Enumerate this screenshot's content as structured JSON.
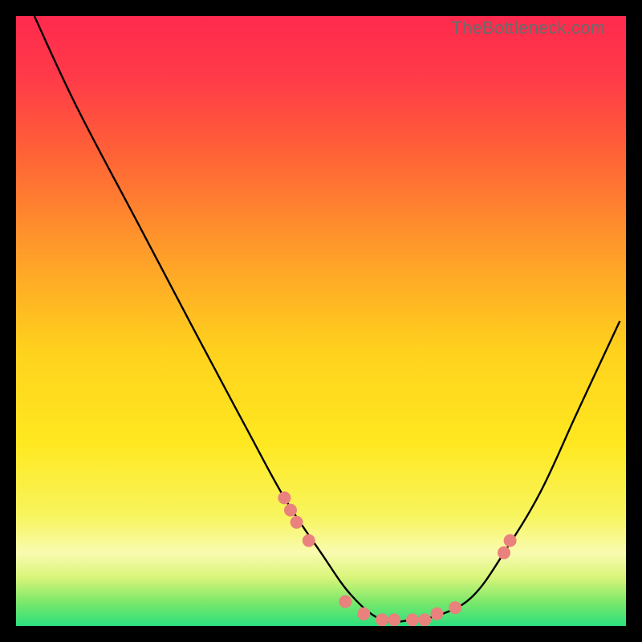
{
  "watermark": "TheBottleneck.com",
  "colors": {
    "gradient_stops": [
      {
        "offset": 0.0,
        "color": "#ff2a4e"
      },
      {
        "offset": 0.1,
        "color": "#ff3a49"
      },
      {
        "offset": 0.22,
        "color": "#ff6037"
      },
      {
        "offset": 0.38,
        "color": "#ff9a2a"
      },
      {
        "offset": 0.55,
        "color": "#ffd21d"
      },
      {
        "offset": 0.7,
        "color": "#ffe820"
      },
      {
        "offset": 0.82,
        "color": "#f7f55e"
      },
      {
        "offset": 0.88,
        "color": "#f9fbb0"
      },
      {
        "offset": 0.92,
        "color": "#d9f57a"
      },
      {
        "offset": 0.96,
        "color": "#7de86a"
      },
      {
        "offset": 1.0,
        "color": "#2be07d"
      }
    ],
    "curve_stroke": "#000000",
    "dot_fill": "#e9817d",
    "frame_bg": "#000000"
  },
  "chart_data": {
    "type": "line",
    "title": "",
    "xlabel": "",
    "ylabel": "",
    "xlim": [
      0,
      100
    ],
    "ylim": [
      0,
      100
    ],
    "series": [
      {
        "name": "bottleneck-curve",
        "x": [
          3,
          10,
          20,
          30,
          38,
          44,
          50,
          55,
          60,
          65,
          70,
          75,
          80,
          86,
          92,
          99
        ],
        "values": [
          100,
          85,
          66,
          47,
          32,
          21,
          12,
          5,
          1,
          1,
          2,
          5,
          12,
          22,
          35,
          50
        ]
      }
    ],
    "dots": {
      "name": "highlighted-points",
      "x": [
        44,
        45,
        46,
        48,
        54,
        57,
        60,
        62,
        65,
        67,
        69,
        72,
        80,
        81
      ],
      "values": [
        21,
        19,
        17,
        14,
        4,
        2,
        1,
        1,
        1,
        1,
        2,
        3,
        12,
        14
      ]
    }
  }
}
